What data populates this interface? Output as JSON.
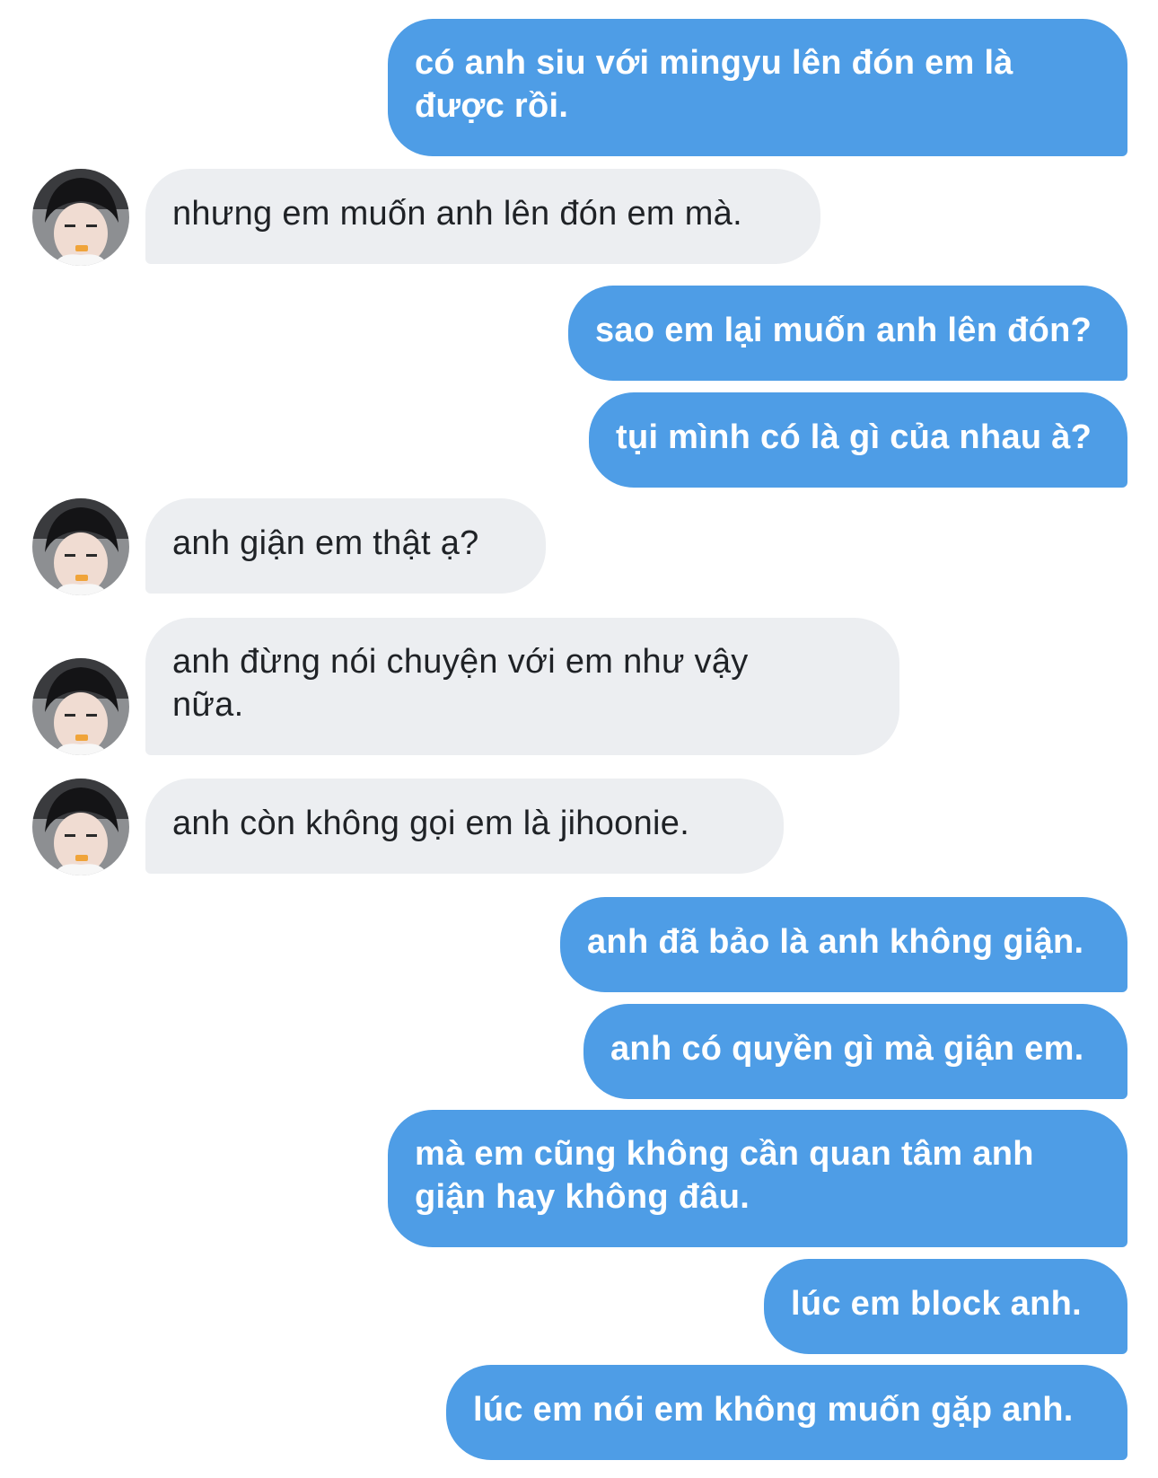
{
  "conversation": {
    "messages": [
      {
        "sender": "me",
        "text": "có anh siu với mingyu lên đón em là\nđược rồi."
      },
      {
        "sender": "them",
        "text": "nhưng em muốn anh lên đón em mà."
      },
      {
        "sender": "me",
        "text": "sao em lại muốn anh lên đón?"
      },
      {
        "sender": "me",
        "text": "tụi mình có là gì của nhau à?"
      },
      {
        "sender": "them",
        "text": "anh giận em thật ạ?"
      },
      {
        "sender": "them",
        "text": "anh đừng nói chuyện với em như vậy\nnữa."
      },
      {
        "sender": "them",
        "text": "anh còn không gọi em là jihoonie."
      },
      {
        "sender": "me",
        "text": "anh đã bảo là anh không giận."
      },
      {
        "sender": "me",
        "text": "anh có quyền gì mà giận em."
      },
      {
        "sender": "me",
        "text": "mà em cũng không cần quan tâm anh\ngiận hay không đâu."
      },
      {
        "sender": "me",
        "text": "lúc em block anh."
      },
      {
        "sender": "me",
        "text": "lúc em nói em không muốn gặp anh."
      }
    ]
  },
  "colors": {
    "outgoing_bubble": "#4e9de6",
    "incoming_bubble": "#eceef1",
    "outgoing_text": "#ffffff",
    "incoming_text": "#1f2226"
  },
  "icons": {
    "avatar": "contact-avatar-photo"
  }
}
